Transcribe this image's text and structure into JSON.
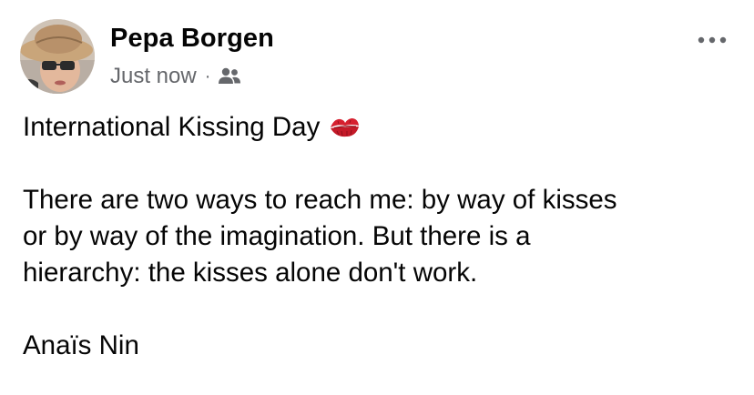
{
  "post": {
    "author": "Pepa Borgen",
    "timestamp": "Just now",
    "separator": "·",
    "audience_icon": "friends-icon",
    "more_icon": "more-options-icon",
    "title_line": "International Kissing Day",
    "title_emoji_icon": "kiss-mark-icon",
    "quote_lines": [
      "There are two ways to reach me: by way of kisses",
      "or by way of the imagination. But there is a",
      "hierarchy: the kisses alone don't work."
    ],
    "attribution": "Anaïs Nin"
  },
  "colors": {
    "text_primary": "#050505",
    "text_secondary": "#65676b",
    "kiss_red": "#d6202f"
  }
}
